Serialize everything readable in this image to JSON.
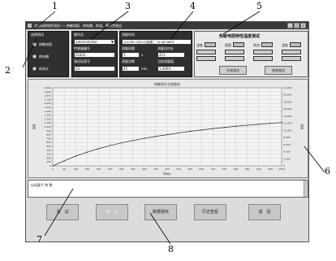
{
  "window": {
    "title": "全自动热电性测试——热敏电阻、热电偶、热流、塞贝克效应",
    "controls": [
      "_",
      "□",
      "×"
    ]
  },
  "left_panel": {
    "title": "选择测试",
    "options": [
      "热敏电阻",
      "热电偶",
      "热流计"
    ],
    "selected_index": 0
  },
  "operator": {
    "label": "操作员",
    "value": "administrator",
    "device_label": "传感器编号",
    "device_value": "ZL831",
    "number_label": "测试标签号",
    "number_value": "03"
  },
  "timing": {
    "label": "测量时间",
    "value": "2022年11月22日星期二 16:46:06PM",
    "interval_label": "测量间隔",
    "interval_value": "5",
    "interval_unit": "s",
    "total_label": "测量总时长",
    "total_value": "45",
    "total_unit": "min",
    "count_label": "测量次数",
    "count_value": "411",
    "result_label": "当前测量值",
    "result_value": "1.4904"
  },
  "right_panel": {
    "title": "热敏电阻特性温度测试",
    "col_labels": [
      "温度",
      "阻值",
      "热流",
      "温度"
    ],
    "start_button": "开始测试",
    "stop_button": "结束测试"
  },
  "chart_data": {
    "type": "line",
    "title": "热敏测试全程曲线",
    "xlabel": "时间/s",
    "ylabel_left": "温度",
    "ylabel_right": "阻值",
    "xlim": [
      0,
      1000
    ],
    "ylim": [
      0,
      2000
    ],
    "y2lim": [
      0,
      22000
    ],
    "x_ticks": [
      "0",
      "50",
      "100",
      "150",
      "200",
      "250",
      "300",
      "350",
      "400",
      "450",
      "500",
      "550",
      "600",
      "650",
      "700",
      "750",
      "800",
      "850",
      "900",
      "950",
      "1000"
    ],
    "y_ticks": [
      "0",
      "100",
      "200",
      "300",
      "400",
      "500",
      "600",
      "700",
      "800",
      "900",
      "1,000",
      "1,100",
      "1,200",
      "1,300",
      "1,400",
      "1,500",
      "1,600",
      "1,700",
      "1,800",
      "1,900",
      "2,000"
    ],
    "y2_ticks": [
      "0",
      "2,000",
      "4,000",
      "6,000",
      "8,000",
      "10,000",
      "12,000",
      "14,000",
      "16,000",
      "18,000",
      "20,000",
      "22,000"
    ],
    "series": [
      {
        "color": "#222222",
        "x": [
          0,
          50,
          100,
          150,
          200,
          250,
          300,
          350,
          400,
          450,
          500,
          550,
          600,
          650,
          700,
          750,
          800,
          850,
          900,
          950,
          1000
        ],
        "y": [
          0,
          130,
          250,
          350,
          440,
          520,
          590,
          650,
          705,
          755,
          800,
          845,
          885,
          920,
          955,
          985,
          1015,
          1040,
          1065,
          1090,
          1110
        ]
      }
    ]
  },
  "log": {
    "text": "自动量子 热 数"
  },
  "buttons": {
    "test": "测　试",
    "stop": "停　止",
    "save": "数据保存",
    "history": "历史查看",
    "back": "返　回"
  },
  "callouts": [
    "1",
    "2",
    "3",
    "4",
    "5",
    "6",
    "7",
    "8"
  ]
}
